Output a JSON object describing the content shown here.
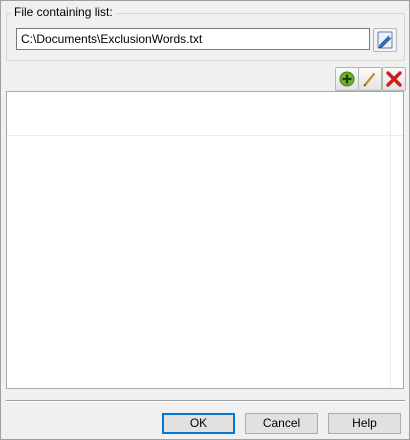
{
  "file_group": {
    "legend": "File containing list:",
    "path_value": "C:\\Documents\\ExclusionWords.txt",
    "browse_icon": "pencil-edit-icon"
  },
  "toolbar": {
    "add_icon": "add-icon",
    "edit_icon": "edit-icon",
    "delete_icon": "delete-icon",
    "colors": {
      "add": "#5aa11f",
      "delete": "#d01c1c",
      "edit": "#c98a2b"
    }
  },
  "buttons": {
    "ok": "OK",
    "cancel": "Cancel",
    "help": "Help"
  }
}
